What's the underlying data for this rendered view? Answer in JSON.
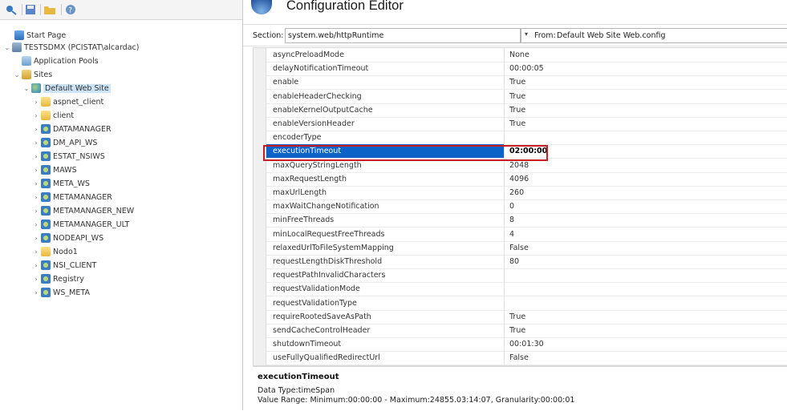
{
  "colors": {
    "selection": "#0b63c7",
    "highlight_border": "#c81d25",
    "tree_selection": "#cce4f7"
  },
  "toolbar": {
    "icons": [
      "connect-icon",
      "save-icon",
      "open-icon",
      "help-icon"
    ]
  },
  "tree": {
    "items": [
      {
        "label": "Start Page",
        "icon": "start-page-icon"
      },
      {
        "label": "TESTSDMX (PCISTAT\\alcardac)",
        "icon": "server-icon"
      },
      {
        "label": "Application Pools",
        "icon": "app-pools-icon"
      },
      {
        "label": "Sites",
        "icon": "sites-folder-icon"
      },
      {
        "label": "Default Web Site",
        "icon": "globe-icon"
      },
      {
        "label": "aspnet_client",
        "icon": "folder-icon"
      },
      {
        "label": "client",
        "icon": "folder-icon"
      },
      {
        "label": "DATAMANAGER",
        "icon": "application-icon"
      },
      {
        "label": "DM_API_WS",
        "icon": "application-icon"
      },
      {
        "label": "ESTAT_NSIWS",
        "icon": "application-icon"
      },
      {
        "label": "MAWS",
        "icon": "application-icon"
      },
      {
        "label": "META_WS",
        "icon": "application-icon"
      },
      {
        "label": "METAMANAGER",
        "icon": "application-icon"
      },
      {
        "label": "METAMANAGER_NEW",
        "icon": "application-icon"
      },
      {
        "label": "METAMANAGER_ULT",
        "icon": "application-icon"
      },
      {
        "label": "NODEAPI_WS",
        "icon": "application-icon"
      },
      {
        "label": "Nodo1",
        "icon": "folder-icon"
      },
      {
        "label": "NSI_CLIENT",
        "icon": "application-icon"
      },
      {
        "label": "Registry",
        "icon": "application-icon"
      },
      {
        "label": "WS_META",
        "icon": "application-icon"
      }
    ]
  },
  "header": {
    "title": "Configuration Editor",
    "icon": "configuration-editor-icon"
  },
  "section": {
    "label": "Section:",
    "value": "system.web/httpRuntime",
    "from_label": "From:",
    "from_value": "Default Web Site Web.config"
  },
  "grid": {
    "rows": [
      {
        "name": "asyncPreloadMode",
        "value": "None"
      },
      {
        "name": "delayNotificationTimeout",
        "value": "00:00:05"
      },
      {
        "name": "enable",
        "value": "True"
      },
      {
        "name": "enableHeaderChecking",
        "value": "True"
      },
      {
        "name": "enableKernelOutputCache",
        "value": "True"
      },
      {
        "name": "enableVersionHeader",
        "value": "True"
      },
      {
        "name": "encoderType",
        "value": ""
      },
      {
        "name": "executionTimeout",
        "value": "02:00:00"
      },
      {
        "name": "maxQueryStringLength",
        "value": "2048"
      },
      {
        "name": "maxRequestLength",
        "value": "4096"
      },
      {
        "name": "maxUrlLength",
        "value": "260"
      },
      {
        "name": "maxWaitChangeNotification",
        "value": "0"
      },
      {
        "name": "minFreeThreads",
        "value": "8"
      },
      {
        "name": "minLocalRequestFreeThreads",
        "value": "4"
      },
      {
        "name": "relaxedUrlToFileSystemMapping",
        "value": "False"
      },
      {
        "name": "requestLengthDiskThreshold",
        "value": "80"
      },
      {
        "name": "requestPathInvalidCharacters",
        "value": ""
      },
      {
        "name": "requestValidationMode",
        "value": ""
      },
      {
        "name": "requestValidationType",
        "value": ""
      },
      {
        "name": "requireRootedSaveAsPath",
        "value": "True"
      },
      {
        "name": "sendCacheControlHeader",
        "value": "True"
      },
      {
        "name": "shutdownTimeout",
        "value": "00:01:30"
      },
      {
        "name": "useFullyQualifiedRedirectUrl",
        "value": "False"
      }
    ],
    "selected_index": 7
  },
  "description": {
    "title": "executionTimeout",
    "type": "Data Type:timeSpan",
    "range": "Value Range: Minimum:00:00:00 - Maximum:24855.03:14:07, Granularity:00:00:01"
  }
}
